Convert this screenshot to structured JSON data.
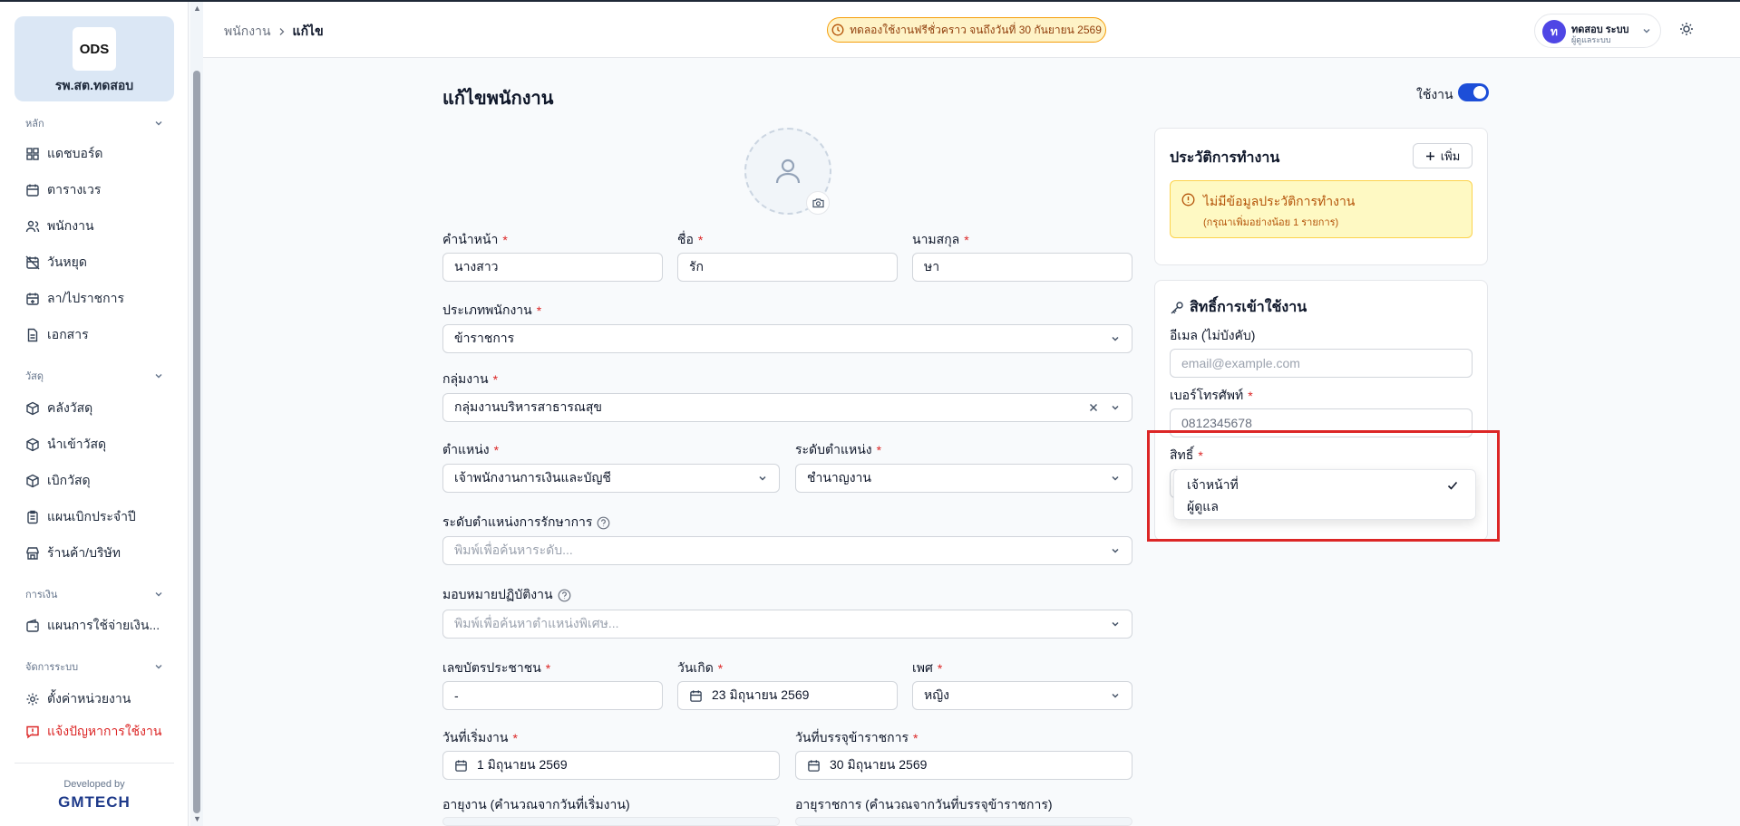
{
  "sidebar": {
    "org_name": "รพ.สต.ทดสอบ",
    "logo_text": "ODS",
    "sections": [
      {
        "title": "หลัก",
        "items": [
          "แดชบอร์ด",
          "ตารางเวร",
          "พนักงาน",
          "วันหยุด",
          "ลา/ไปราชการ",
          "เอกสาร"
        ]
      },
      {
        "title": "วัสดุ",
        "items": [
          "คลังวัสดุ",
          "นำเข้าวัสดุ",
          "เบิกวัสดุ",
          "แผนเบิกประจำปี",
          "ร้านค้า/บริษัท"
        ]
      },
      {
        "title": "การเงิน",
        "items": [
          "แผนการใช้จ่ายเงิน..."
        ]
      },
      {
        "title": "จัดการระบบ",
        "items": [
          "ตั้งค่าหน่วยงาน",
          "แจ้งปัญหาการใช้งาน"
        ]
      }
    ],
    "developed_by": "Developed by",
    "developer": "GMTECH"
  },
  "header": {
    "breadcrumb": [
      "พนักงาน",
      "แก้ไข"
    ],
    "trial_notice": "ทดลองใช้งานฟรีชั่วคราว จนถึงวันที่ 30 กันยายน 2569",
    "user": {
      "initial": "ท",
      "name": "ทดสอบ ระบบ",
      "role": "ผู้ดูแลระบบ"
    }
  },
  "form": {
    "title": "แก้ไขพนักงาน",
    "active_label": "ใช้งาน",
    "active": true,
    "fields": {
      "prefix": {
        "label": "คำนำหน้า",
        "value": "นางสาว"
      },
      "first_name": {
        "label": "ชื่อ",
        "value": "รัก"
      },
      "last_name": {
        "label": "นามสกุล",
        "value": "ษา"
      },
      "employee_type": {
        "label": "ประเภทพนักงาน",
        "value": "ข้าราชการ"
      },
      "work_group": {
        "label": "กลุ่มงาน",
        "value": "กลุ่มงานบริหารสาธารณสุข"
      },
      "position": {
        "label": "ตำแหน่ง",
        "value": "เจ้าพนักงานการเงินและบัญชี"
      },
      "position_level": {
        "label": "ระดับตำแหน่ง",
        "value": "ชำนาญงาน"
      },
      "acting_level": {
        "label": "ระดับตำแหน่งการรักษาการ",
        "placeholder": "พิมพ์เพื่อค้นหาระดับ..."
      },
      "assignment": {
        "label": "มอบหมายปฏิบัติงาน",
        "placeholder": "พิมพ์เพื่อค้นหาตำแหน่งพิเศษ..."
      },
      "id_card": {
        "label": "เลขบัตรประชาชน",
        "value": "-"
      },
      "birth_date": {
        "label": "วันเกิด",
        "value": "23 มิถุนายน 2569"
      },
      "gender": {
        "label": "เพศ",
        "value": "หญิง"
      },
      "start_date": {
        "label": "วันที่เริ่มงาน",
        "value": "1 มิถุนายน 2569"
      },
      "appointment_date": {
        "label": "วันที่บรรจุข้าราชการ",
        "value": "30 มิถุนายน 2569"
      },
      "work_age": {
        "label": "อายุงาน (คำนวณจากวันที่เริ่มงาน)"
      },
      "gov_age": {
        "label": "อายุราชการ (คำนวณจากวันที่บรรจุข้าราชการ)"
      }
    }
  },
  "work_history": {
    "title": "ประวัติการทำงาน",
    "add_label": "เพิ่ม",
    "empty_title": "ไม่มีข้อมูลประวัติการทำงาน",
    "empty_subtitle": "(กรุณาเพิ่มอย่างน้อย 1 รายการ)"
  },
  "access": {
    "title": "สิทธิ์การเข้าใช้งาน",
    "email_label": "อีเมล (ไม่บังคับ)",
    "email_placeholder": "email@example.com",
    "phone_label": "เบอร์โทรศัพท์",
    "phone_value": "0812345678",
    "role_label": "สิทธิ์",
    "role_options": [
      "เจ้าหน้าที่",
      "ผู้ดูแล"
    ],
    "selected_role": "เจ้าหน้าที่"
  },
  "colors": {
    "accent": "#1d4ed8",
    "required": "#dc2626",
    "warning": "#b45309",
    "highlight": "#dc2626"
  }
}
